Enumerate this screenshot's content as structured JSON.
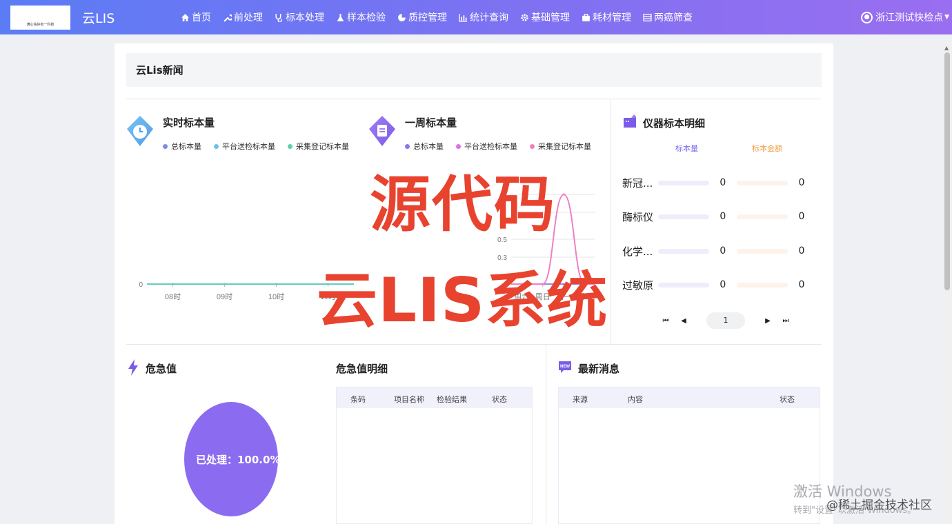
{
  "header": {
    "logo_text": "满心信好有一科技",
    "app_title": "云LIS",
    "nav": [
      {
        "label": "首页",
        "icon": "home-icon"
      },
      {
        "label": "前处理",
        "icon": "wrench-icon"
      },
      {
        "label": "标本处理",
        "icon": "stethoscope-icon"
      },
      {
        "label": "样本检验",
        "icon": "flask-icon"
      },
      {
        "label": "质控管理",
        "icon": "pie-icon"
      },
      {
        "label": "统计查询",
        "icon": "bar-chart-icon"
      },
      {
        "label": "基础管理",
        "icon": "gear-icon"
      },
      {
        "label": "耗材管理",
        "icon": "briefcase-icon"
      },
      {
        "label": "两癌筛查",
        "icon": "table-icon"
      }
    ],
    "user": "浙江测试快检点"
  },
  "news": {
    "title": "云Lis新闻"
  },
  "realtime": {
    "title": "实时标本量",
    "legend": [
      "总标本量",
      "平台送检标本量",
      "采集登记标本量"
    ]
  },
  "weekly": {
    "title": "一周标本量",
    "legend": [
      "总标本量",
      "平台送检标本量",
      "采集登记标本量"
    ]
  },
  "instruments": {
    "title": "仪器标本明细",
    "col_count": "标本量",
    "col_amount": "标本金额",
    "rows": [
      {
        "name": "新冠...",
        "count": "0",
        "amount": "0"
      },
      {
        "name": "酶标仪",
        "count": "0",
        "amount": "0"
      },
      {
        "name": "化学...",
        "count": "0",
        "amount": "0"
      },
      {
        "name": "过敏原",
        "count": "0",
        "amount": "0"
      }
    ],
    "page": "1"
  },
  "critical": {
    "title": "危急值",
    "pie_label": "已处理：100.0%",
    "processed_pct": 100.0
  },
  "critical_detail": {
    "title": "危急值明细",
    "columns": [
      "条码",
      "项目名称",
      "检验结果",
      "状态"
    ]
  },
  "messages": {
    "title": "最新消息",
    "badge": "NEW",
    "columns": [
      "来源",
      "内容",
      "状态"
    ]
  },
  "watermark": {
    "line1": "源代码",
    "line2": "云LIS系统"
  },
  "windows_activation": {
    "line1": "激活 Windows",
    "line2": "转到\"设置\"以激活 Windows。"
  },
  "site_watermark": "@稀土掘金技术社区",
  "chart_data": [
    {
      "type": "line",
      "title": "实时标本量",
      "categories": [
        "08时",
        "09时",
        "10时",
        "11时"
      ],
      "series": [
        {
          "name": "总标本量",
          "values": [
            0,
            0,
            0,
            0
          ],
          "color": "#7b8ce8"
        },
        {
          "name": "平台送检标本量",
          "values": [
            0,
            0,
            0,
            0
          ],
          "color": "#6fc0f0"
        },
        {
          "name": "采集登记标本量",
          "values": [
            0,
            0,
            0,
            0
          ],
          "color": "#5fd0b0"
        }
      ],
      "yticks": [
        "0"
      ]
    },
    {
      "type": "line",
      "title": "一周标本量",
      "categories": [
        "周六",
        "周日",
        "周一",
        "周二"
      ],
      "series": [
        {
          "name": "总标本量",
          "values": [
            0,
            0,
            0,
            0
          ],
          "color": "#8a78e8"
        },
        {
          "name": "平台送检标本量",
          "values": [
            0,
            0,
            1,
            0
          ],
          "color": "#e070e8"
        },
        {
          "name": "采集登记标本量",
          "values": [
            0,
            0,
            1,
            0
          ],
          "color": "#f080c0"
        }
      ],
      "yticks": [
        "0.3",
        "0.5"
      ]
    }
  ],
  "colors": {
    "accent": "#7b6ef0",
    "pie": "#8b6cf0",
    "watermark": "#e8432f"
  }
}
